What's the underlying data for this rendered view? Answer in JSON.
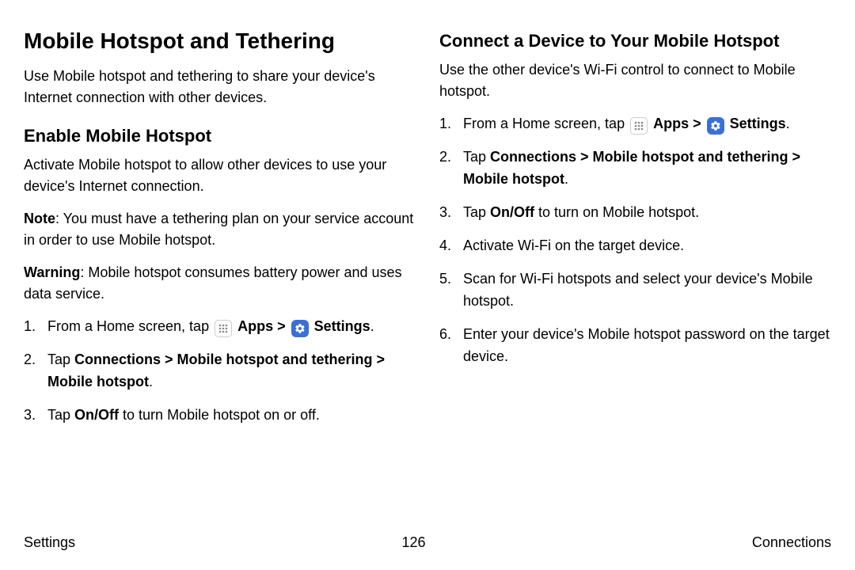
{
  "left": {
    "h1": "Mobile Hotspot and Tethering",
    "intro": "Use Mobile hotspot and tethering to share your device's Internet connection with other devices.",
    "h2": "Enable Mobile Hotspot",
    "enable_intro": "Activate Mobile hotspot to allow other devices to use your device's Internet connection.",
    "note_label": "Note",
    "note_text": ": You must have a tethering plan on your service account in order to use Mobile hotspot.",
    "warn_label": "Warning",
    "warn_text": ": Mobile hotspot consumes battery power and uses data service.",
    "steps": {
      "s1_pre": "From a Home screen, tap ",
      "s1_apps": "Apps",
      "s1_gt": " > ",
      "s1_settings": "Settings",
      "s1_post": ".",
      "s2_pre": "Tap ",
      "s2_path": "Connections > Mobile hotspot and tethering > Mobile hotspot",
      "s2_post": ".",
      "s3_pre": "Tap ",
      "s3_onoff": "On/Off",
      "s3_post": " to turn Mobile hotspot on or off."
    }
  },
  "right": {
    "h2": "Connect a Device to Your Mobile Hotspot",
    "intro": "Use the other device's Wi-Fi control to connect to Mobile hotspot.",
    "steps": {
      "s1_pre": "From a Home screen, tap ",
      "s1_apps": "Apps",
      "s1_gt": " > ",
      "s1_settings": "Settings",
      "s1_post": ".",
      "s2_pre": "Tap ",
      "s2_path": "Connections > Mobile hotspot and tethering > Mobile hotspot",
      "s2_post": ".",
      "s3_pre": "Tap ",
      "s3_onoff": "On/Off",
      "s3_post": " to turn on Mobile hotspot.",
      "s4": "Activate Wi-Fi on the target device.",
      "s5": "Scan for Wi-Fi hotspots and select your device's Mobile hotspot.",
      "s6": "Enter your device's Mobile hotspot password on the target device."
    }
  },
  "footer": {
    "left": "Settings",
    "center": "126",
    "right": "Connections"
  }
}
